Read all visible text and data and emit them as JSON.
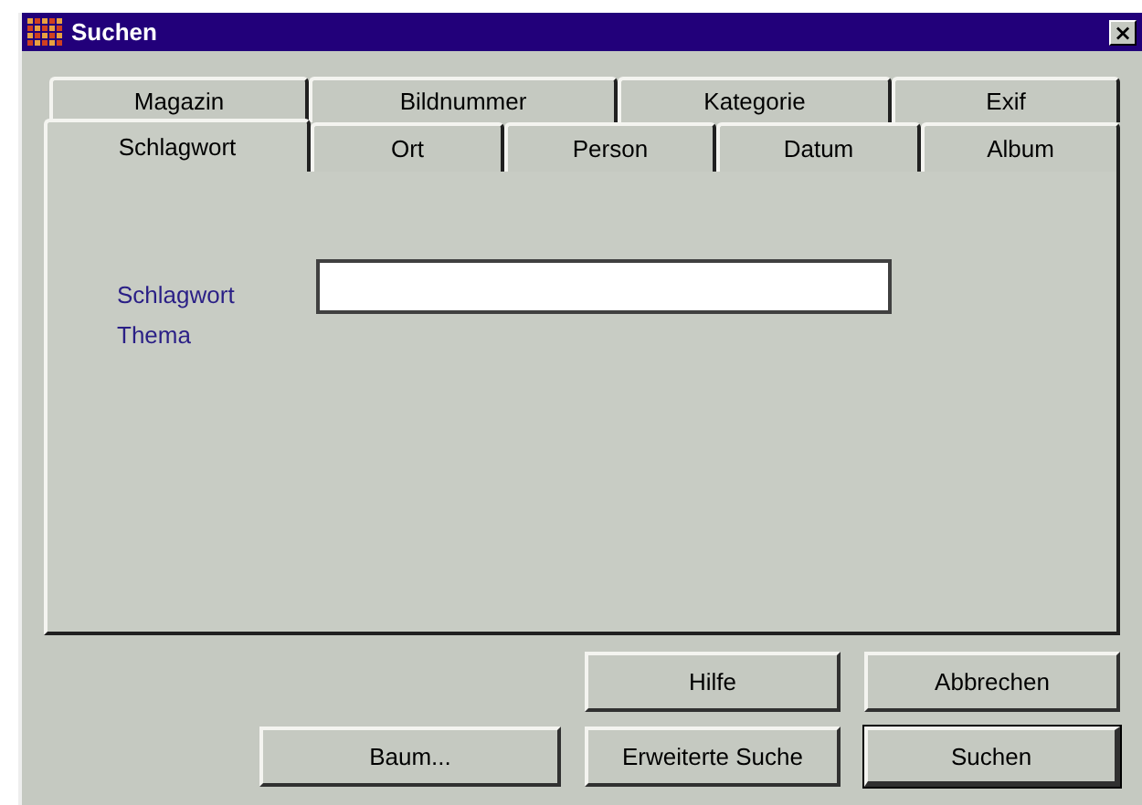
{
  "window": {
    "title": "Suchen",
    "close": "×"
  },
  "tabs": [
    [
      {
        "label": "Magazin",
        "selected": false
      },
      {
        "label": "Bildnummer",
        "selected": false
      },
      {
        "label": "Kategorie",
        "selected": false
      },
      {
        "label": "Exif",
        "selected": false
      }
    ],
    [
      {
        "label": "Schlagwort",
        "selected": true
      },
      {
        "label": "Ort",
        "selected": false
      },
      {
        "label": "Person",
        "selected": false
      },
      {
        "label": "Datum",
        "selected": false
      },
      {
        "label": "Album",
        "selected": false
      }
    ]
  ],
  "form": {
    "labels": [
      "Schlagwort",
      "Thema"
    ]
  },
  "buttons": [
    [
      {
        "label": "Hilfe",
        "default": false
      },
      {
        "label": "Abbrechen",
        "default": false
      }
    ],
    [
      {
        "label": "Baum...",
        "default": false
      },
      {
        "label": "Erweiterte Suche",
        "default": false
      },
      {
        "label": "Suchen",
        "default": true
      }
    ]
  ]
}
